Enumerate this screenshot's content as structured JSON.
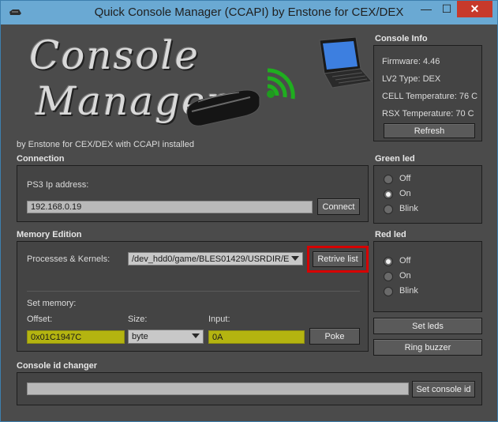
{
  "window": {
    "title": "Quick Console Manager (CCAPI) by Enstone for CEX/DEX",
    "minimize_glyph": "—",
    "maximize_glyph": "☐",
    "close_glyph": "✕"
  },
  "logo": {
    "line1": "Console",
    "line2": "Manager",
    "byline": "by Enstone for CEX/DEX with CCAPI installed"
  },
  "console_info": {
    "section_label": "Console Info",
    "firmware": "Firmware: 4.46",
    "lv2_type": "LV2 Type: DEX",
    "cell_temp": "CELL Temperature: 76 C",
    "rsx_temp": "RSX Temperature: 70 C",
    "refresh_label": "Refresh"
  },
  "connection": {
    "section_label": "Connection",
    "ip_label": "PS3 Ip address:",
    "ip_value": "192.168.0.19",
    "connect_label": "Connect"
  },
  "green_led": {
    "section_label": "Green led",
    "options": [
      "Off",
      "On",
      "Blink"
    ],
    "selected": "On"
  },
  "memory": {
    "section_label": "Memory Edition",
    "processes_label": "Processes & Kernels:",
    "process_value": "/dev_hdd0/game/BLES01429/USRDIR/E",
    "retrive_label": "Retrive list",
    "set_memory_label": "Set memory:",
    "offset_label": "Offset:",
    "offset_value": "0x01C1947C",
    "size_label": "Size:",
    "size_value": "byte",
    "input_label": "Input:",
    "input_value": "0A",
    "poke_label": "Poke"
  },
  "red_led": {
    "section_label": "Red led",
    "options": [
      "Off",
      "On",
      "Blink"
    ],
    "selected": "Off"
  },
  "actions": {
    "set_leds_label": "Set leds",
    "ring_buzzer_label": "Ring buzzer"
  },
  "console_id": {
    "section_label": "Console id changer",
    "value": "",
    "set_label": "Set console id"
  },
  "colors": {
    "titlebar": "#6aa9d3",
    "panel": "#4b4b4b",
    "highlight": "#d60000",
    "yellow_field": "#b4b410"
  }
}
